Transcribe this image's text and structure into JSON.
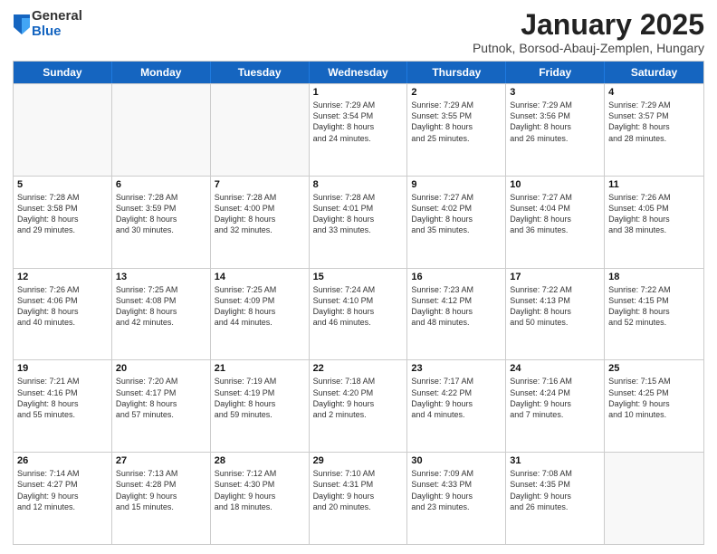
{
  "logo": {
    "general": "General",
    "blue": "Blue"
  },
  "title": {
    "month": "January 2025",
    "location": "Putnok, Borsod-Abauj-Zemplen, Hungary"
  },
  "days_of_week": [
    "Sunday",
    "Monday",
    "Tuesday",
    "Wednesday",
    "Thursday",
    "Friday",
    "Saturday"
  ],
  "weeks": [
    [
      {
        "day": "",
        "info": ""
      },
      {
        "day": "",
        "info": ""
      },
      {
        "day": "",
        "info": ""
      },
      {
        "day": "1",
        "info": "Sunrise: 7:29 AM\nSunset: 3:54 PM\nDaylight: 8 hours\nand 24 minutes."
      },
      {
        "day": "2",
        "info": "Sunrise: 7:29 AM\nSunset: 3:55 PM\nDaylight: 8 hours\nand 25 minutes."
      },
      {
        "day": "3",
        "info": "Sunrise: 7:29 AM\nSunset: 3:56 PM\nDaylight: 8 hours\nand 26 minutes."
      },
      {
        "day": "4",
        "info": "Sunrise: 7:29 AM\nSunset: 3:57 PM\nDaylight: 8 hours\nand 28 minutes."
      }
    ],
    [
      {
        "day": "5",
        "info": "Sunrise: 7:28 AM\nSunset: 3:58 PM\nDaylight: 8 hours\nand 29 minutes."
      },
      {
        "day": "6",
        "info": "Sunrise: 7:28 AM\nSunset: 3:59 PM\nDaylight: 8 hours\nand 30 minutes."
      },
      {
        "day": "7",
        "info": "Sunrise: 7:28 AM\nSunset: 4:00 PM\nDaylight: 8 hours\nand 32 minutes."
      },
      {
        "day": "8",
        "info": "Sunrise: 7:28 AM\nSunset: 4:01 PM\nDaylight: 8 hours\nand 33 minutes."
      },
      {
        "day": "9",
        "info": "Sunrise: 7:27 AM\nSunset: 4:02 PM\nDaylight: 8 hours\nand 35 minutes."
      },
      {
        "day": "10",
        "info": "Sunrise: 7:27 AM\nSunset: 4:04 PM\nDaylight: 8 hours\nand 36 minutes."
      },
      {
        "day": "11",
        "info": "Sunrise: 7:26 AM\nSunset: 4:05 PM\nDaylight: 8 hours\nand 38 minutes."
      }
    ],
    [
      {
        "day": "12",
        "info": "Sunrise: 7:26 AM\nSunset: 4:06 PM\nDaylight: 8 hours\nand 40 minutes."
      },
      {
        "day": "13",
        "info": "Sunrise: 7:25 AM\nSunset: 4:08 PM\nDaylight: 8 hours\nand 42 minutes."
      },
      {
        "day": "14",
        "info": "Sunrise: 7:25 AM\nSunset: 4:09 PM\nDaylight: 8 hours\nand 44 minutes."
      },
      {
        "day": "15",
        "info": "Sunrise: 7:24 AM\nSunset: 4:10 PM\nDaylight: 8 hours\nand 46 minutes."
      },
      {
        "day": "16",
        "info": "Sunrise: 7:23 AM\nSunset: 4:12 PM\nDaylight: 8 hours\nand 48 minutes."
      },
      {
        "day": "17",
        "info": "Sunrise: 7:22 AM\nSunset: 4:13 PM\nDaylight: 8 hours\nand 50 minutes."
      },
      {
        "day": "18",
        "info": "Sunrise: 7:22 AM\nSunset: 4:15 PM\nDaylight: 8 hours\nand 52 minutes."
      }
    ],
    [
      {
        "day": "19",
        "info": "Sunrise: 7:21 AM\nSunset: 4:16 PM\nDaylight: 8 hours\nand 55 minutes."
      },
      {
        "day": "20",
        "info": "Sunrise: 7:20 AM\nSunset: 4:17 PM\nDaylight: 8 hours\nand 57 minutes."
      },
      {
        "day": "21",
        "info": "Sunrise: 7:19 AM\nSunset: 4:19 PM\nDaylight: 8 hours\nand 59 minutes."
      },
      {
        "day": "22",
        "info": "Sunrise: 7:18 AM\nSunset: 4:20 PM\nDaylight: 9 hours\nand 2 minutes."
      },
      {
        "day": "23",
        "info": "Sunrise: 7:17 AM\nSunset: 4:22 PM\nDaylight: 9 hours\nand 4 minutes."
      },
      {
        "day": "24",
        "info": "Sunrise: 7:16 AM\nSunset: 4:24 PM\nDaylight: 9 hours\nand 7 minutes."
      },
      {
        "day": "25",
        "info": "Sunrise: 7:15 AM\nSunset: 4:25 PM\nDaylight: 9 hours\nand 10 minutes."
      }
    ],
    [
      {
        "day": "26",
        "info": "Sunrise: 7:14 AM\nSunset: 4:27 PM\nDaylight: 9 hours\nand 12 minutes."
      },
      {
        "day": "27",
        "info": "Sunrise: 7:13 AM\nSunset: 4:28 PM\nDaylight: 9 hours\nand 15 minutes."
      },
      {
        "day": "28",
        "info": "Sunrise: 7:12 AM\nSunset: 4:30 PM\nDaylight: 9 hours\nand 18 minutes."
      },
      {
        "day": "29",
        "info": "Sunrise: 7:10 AM\nSunset: 4:31 PM\nDaylight: 9 hours\nand 20 minutes."
      },
      {
        "day": "30",
        "info": "Sunrise: 7:09 AM\nSunset: 4:33 PM\nDaylight: 9 hours\nand 23 minutes."
      },
      {
        "day": "31",
        "info": "Sunrise: 7:08 AM\nSunset: 4:35 PM\nDaylight: 9 hours\nand 26 minutes."
      },
      {
        "day": "",
        "info": ""
      }
    ]
  ]
}
